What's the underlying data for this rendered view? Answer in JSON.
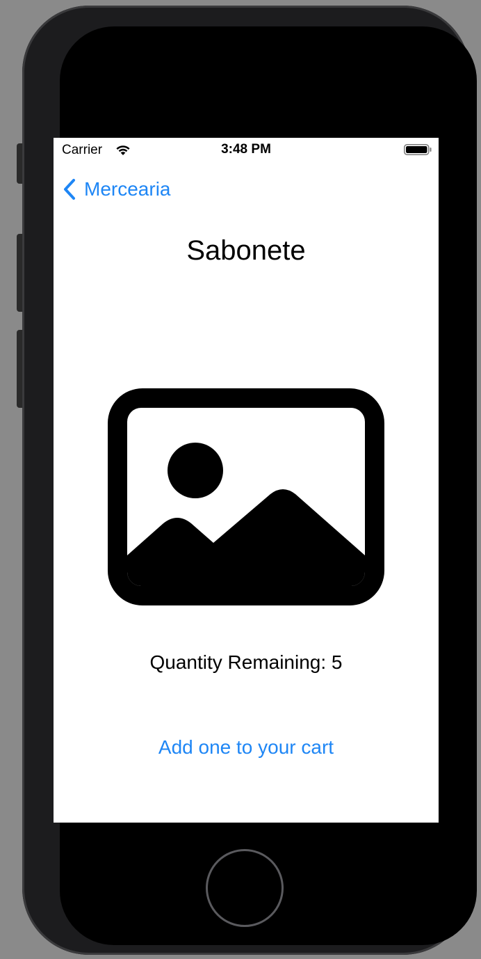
{
  "status_bar": {
    "carrier": "Carrier",
    "time": "3:48 PM",
    "wifi_icon": "wifi-icon",
    "battery_icon": "battery-full-icon"
  },
  "nav": {
    "back_label": "Mercearia",
    "back_icon": "chevron-left-icon"
  },
  "product": {
    "title": "Sabonete",
    "image_icon": "photo-placeholder-icon",
    "quantity_text": "Quantity Remaining: 5",
    "add_button_label": "Add one to your cart"
  },
  "colors": {
    "accent": "#1e86f5",
    "text": "#000000",
    "background": "#ffffff"
  }
}
